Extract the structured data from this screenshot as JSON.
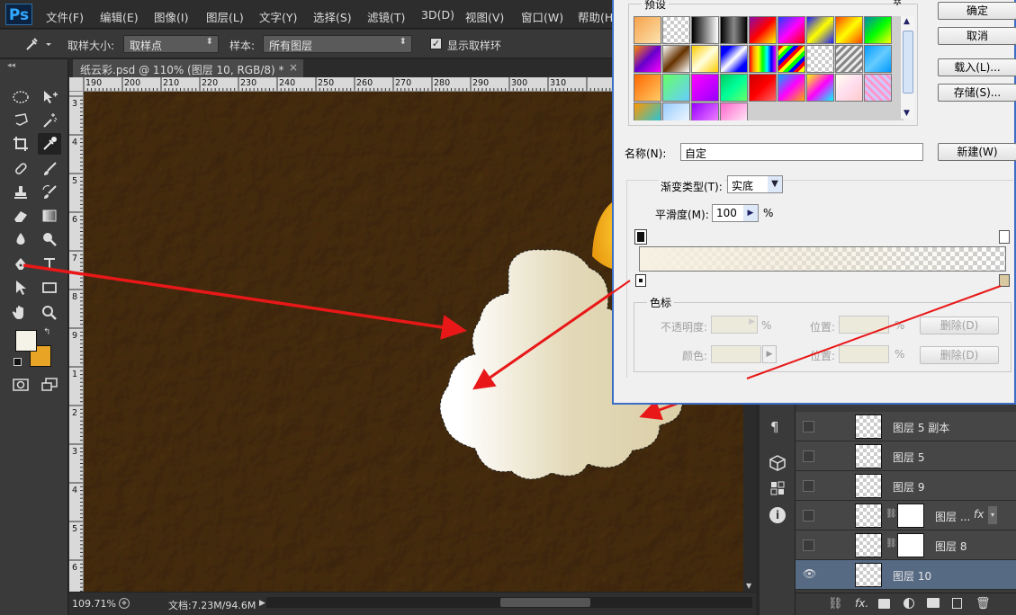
{
  "app": {
    "logo": "Ps"
  },
  "menu": [
    "文件(F)",
    "编辑(E)",
    "图像(I)",
    "图层(L)",
    "文字(Y)",
    "选择(S)",
    "滤镜(T)",
    "3D(D)",
    "视图(V)",
    "窗口(W)",
    "帮助(H)"
  ],
  "options": {
    "sample_size_label": "取样大小:",
    "sample_size_value": "取样点",
    "sample_label": "样本:",
    "sample_value": "所有图层",
    "show_ring_label": "显示取样环",
    "show_ring_checked": true
  },
  "document": {
    "tab_title": "纸云彩.psd @ 110% (图层 10, RGB/8) *",
    "ruler_h": [
      "190",
      "200",
      "210",
      "220",
      "230",
      "240",
      "250",
      "260",
      "270",
      "280",
      "290",
      "300",
      "310"
    ],
    "ruler_v": [
      "3",
      "4",
      "5",
      "6",
      "7",
      "8",
      "9",
      "1",
      "2",
      "3",
      "4",
      "5",
      "6"
    ],
    "zoom": "109.71%",
    "doc_info": "文档:7.23M/94.6M"
  },
  "colors": {
    "foreground": "#f5f2e8",
    "background": "#e8a525",
    "canvas": "#7d6640",
    "cloud_light": "#ffffff",
    "cloud_dark": "#dfd4b0",
    "arrow": "#e81818",
    "sun": "#f0b020"
  },
  "gradient_editor": {
    "presets_label": "预设",
    "ok": "确定",
    "cancel": "取消",
    "load": "载入(L)...",
    "save": "存储(S)...",
    "name_label": "名称(N):",
    "name_value": "自定",
    "new_button": "新建(W)",
    "type_label": "渐变类型(T):",
    "type_value": "实底",
    "smooth_label": "平滑度(M):",
    "smooth_value": "100",
    "percent": "%",
    "stops_group": "色标",
    "opacity_label": "不透明度:",
    "color_label": "颜色:",
    "location_label": "位置:",
    "delete_label": "删除(D)"
  },
  "layers": [
    {
      "name": "图层 5 副本",
      "visible": false,
      "selected": false,
      "mask": false
    },
    {
      "name": "图层 5",
      "visible": false,
      "selected": false,
      "mask": false
    },
    {
      "name": "图层 9",
      "visible": false,
      "selected": false,
      "mask": false
    },
    {
      "name": "图层 ...",
      "visible": false,
      "selected": false,
      "mask": true,
      "fx": "fx"
    },
    {
      "name": "图层 8",
      "visible": false,
      "selected": false,
      "mask": true
    },
    {
      "name": "图层 10",
      "visible": true,
      "selected": true,
      "mask": false
    }
  ]
}
